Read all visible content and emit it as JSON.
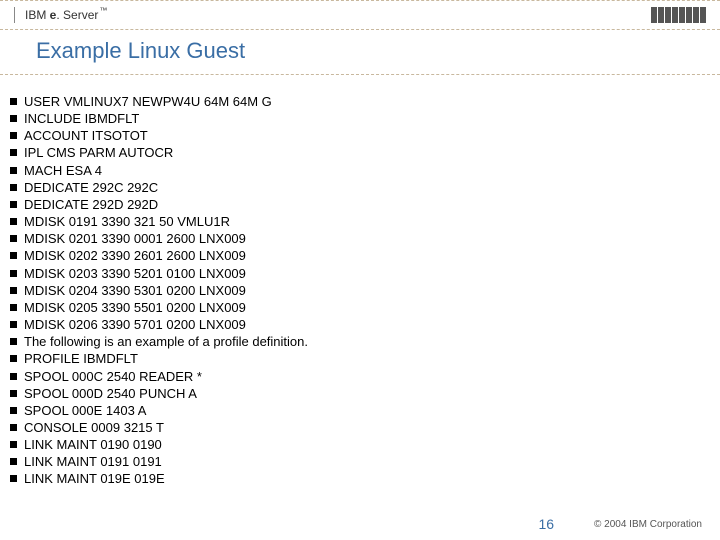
{
  "header": {
    "brand_prefix": "IBM ",
    "brand_em": "e",
    "brand_suffix": ". Server",
    "tm": "™"
  },
  "title": "Example Linux Guest",
  "lines": [
    "USER VMLINUX7 NEWPW4U 64M 64M G",
    "INCLUDE IBMDFLT",
    "ACCOUNT ITSOTOT",
    "IPL CMS PARM AUTOCR",
    "MACH ESA 4",
    "DEDICATE 292C 292C",
    "DEDICATE 292D 292D",
    "MDISK 0191 3390 321 50 VMLU1R",
    "MDISK 0201 3390 0001 2600 LNX009",
    "MDISK 0202 3390 2601 2600 LNX009",
    "MDISK 0203 3390 5201 0100 LNX009",
    "MDISK 0204 3390 5301 0200 LNX009",
    "MDISK 0205 3390 5501 0200 LNX009",
    "MDISK 0206 3390 5701 0200 LNX009",
    "The following is an example of a profile definition.",
    "PROFILE IBMDFLT",
    "SPOOL 000C 2540 READER *",
    "SPOOL 000D 2540 PUNCH A",
    "SPOOL 000E 1403 A",
    "CONSOLE 0009 3215 T",
    "LINK MAINT 0190 0190",
    "LINK MAINT 0191 0191",
    "LINK MAINT 019E 019E"
  ],
  "footer": {
    "page": "16",
    "copyright": "© 2004 IBM Corporation"
  }
}
